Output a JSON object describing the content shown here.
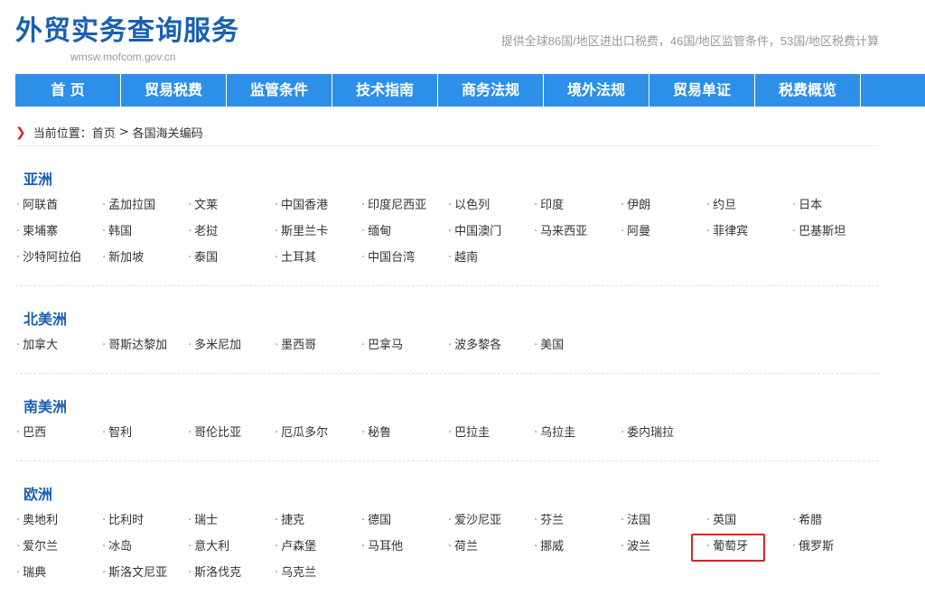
{
  "header": {
    "title": "外贸实务查询服务",
    "domain": "wmsw.mofcom.gov.cn",
    "slogan": "提供全球86国/地区进出口税费，46国/地区监管条件，53国/地区税费计算"
  },
  "nav": {
    "items": [
      "首 页",
      "贸易税费",
      "监管条件",
      "技术指南",
      "商务法规",
      "境外法规",
      "贸易单证",
      "税费概览"
    ]
  },
  "breadcrumb": {
    "prefix": "当前位置：",
    "home": "首页",
    "separator": ">",
    "current": "各国海关编码"
  },
  "regions": [
    {
      "name": "亚洲",
      "countries": [
        "阿联酋",
        "孟加拉国",
        "文莱",
        "中国香港",
        "印度尼西亚",
        "以色列",
        "印度",
        "伊朗",
        "约旦",
        "日本",
        "柬埔寨",
        "韩国",
        "老挝",
        "斯里兰卡",
        "缅甸",
        "中国澳门",
        "马来西亚",
        "阿曼",
        "菲律宾",
        "巴基斯坦",
        "沙特阿拉伯",
        "新加坡",
        "泰国",
        "土耳其",
        "中国台湾",
        "越南"
      ]
    },
    {
      "name": "北美洲",
      "countries": [
        "加拿大",
        "哥斯达黎加",
        "多米尼加",
        "墨西哥",
        "巴拿马",
        "波多黎各",
        "美国"
      ]
    },
    {
      "name": "南美洲",
      "countries": [
        "巴西",
        "智利",
        "哥伦比亚",
        "厄瓜多尔",
        "秘鲁",
        "巴拉圭",
        "乌拉圭",
        "委内瑞拉"
      ]
    },
    {
      "name": "欧洲",
      "countries": [
        "奥地利",
        "比利时",
        "瑞士",
        "捷克",
        "德国",
        "爱沙尼亚",
        "芬兰",
        "法国",
        "英国",
        "希腊",
        "爱尔兰",
        "冰岛",
        "意大利",
        "卢森堡",
        "马耳他",
        "荷兰",
        "挪威",
        "波兰",
        "葡萄牙",
        "俄罗斯",
        "瑞典",
        "斯洛文尼亚",
        "斯洛伐克",
        "乌克兰"
      ]
    }
  ],
  "bullet": "·",
  "colors": {
    "brand": "#1a5fb4",
    "nav": "#2e8fe8",
    "highlight": "#e02020"
  }
}
